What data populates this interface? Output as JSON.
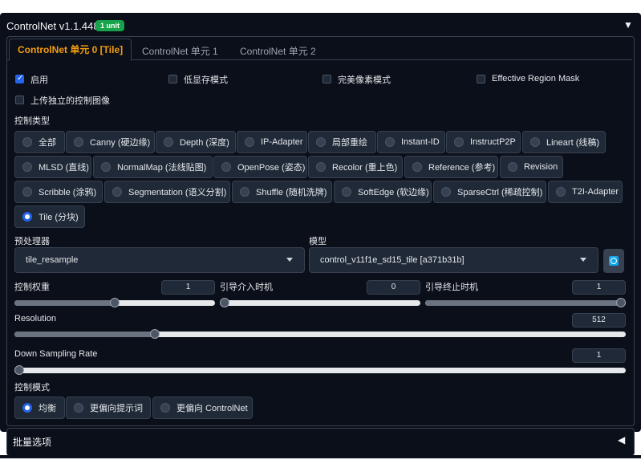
{
  "accordion": {
    "title": "ControlNet v1.1.448",
    "badge": "1 unit",
    "collapse_icon": "triangle-down"
  },
  "tabs": [
    {
      "label": "ControlNet 单元 0 [Tile]",
      "active": true
    },
    {
      "label": "ControlNet 单元 1",
      "active": false
    },
    {
      "label": "ControlNet 单元 2",
      "active": false
    }
  ],
  "checkboxes": {
    "enable": {
      "label": "启用",
      "checked": true
    },
    "low_vram": {
      "label": "低显存模式",
      "checked": false
    },
    "pixel_perfect": {
      "label": "完美像素模式",
      "checked": false
    },
    "effective_region_mask": {
      "label": "Effective Region Mask",
      "checked": false
    },
    "upload_independent": {
      "label": "上传独立的控制图像",
      "checked": false
    }
  },
  "control_type": {
    "label": "控制类型",
    "rows": [
      [
        "全部",
        "Canny (硬边缘)",
        "Depth (深度)",
        "IP-Adapter",
        "局部重绘",
        "Instant-ID",
        "InstructP2P",
        "Lineart (线稿)"
      ],
      [
        "MLSD (直线)",
        "NormalMap (法线贴图)",
        "OpenPose (姿态)",
        "Recolor (重上色)",
        "Reference (参考)",
        "Revision"
      ],
      [
        "Scribble (涂鸦)",
        "Segmentation (语义分割)",
        "Shuffle (随机洗牌)",
        "SoftEdge (软边缘)",
        "SparseCtrl (稀疏控制)",
        "T2I-Adapter"
      ],
      [
        "Tile (分块)"
      ]
    ],
    "selected": "Tile (分块)"
  },
  "preprocessor": {
    "label": "预处理器",
    "value": "tile_resample"
  },
  "model": {
    "label": "模型",
    "value": "control_v11f1e_sd15_tile [a371b31b]",
    "refresh_icon": "refresh-icon"
  },
  "sliders": {
    "control_weight": {
      "label": "控制权重",
      "value": "1",
      "fraction": 0.5
    },
    "start_step": {
      "label": "引导介入时机",
      "value": "0",
      "fraction": 0.0
    },
    "end_step": {
      "label": "引导终止时机",
      "value": "1",
      "fraction": 1.0
    },
    "resolution": {
      "label": "Resolution",
      "value": "512",
      "fraction": 0.23
    },
    "down_sampling": {
      "label": "Down Sampling Rate",
      "value": "1",
      "fraction": 0.0
    }
  },
  "control_mode": {
    "label": "控制模式",
    "options": [
      "均衡",
      "更偏向提示词",
      "更偏向 ControlNet"
    ],
    "selected": "均衡"
  },
  "batch": {
    "title": "批量选项",
    "expand_icon": "triangle-left"
  },
  "colors": {
    "background": "#0b0f19",
    "surface": "#1f2937",
    "border": "#374151",
    "accent": "#f59e0b",
    "badge": "#16a34a",
    "primary": "#2563eb"
  }
}
